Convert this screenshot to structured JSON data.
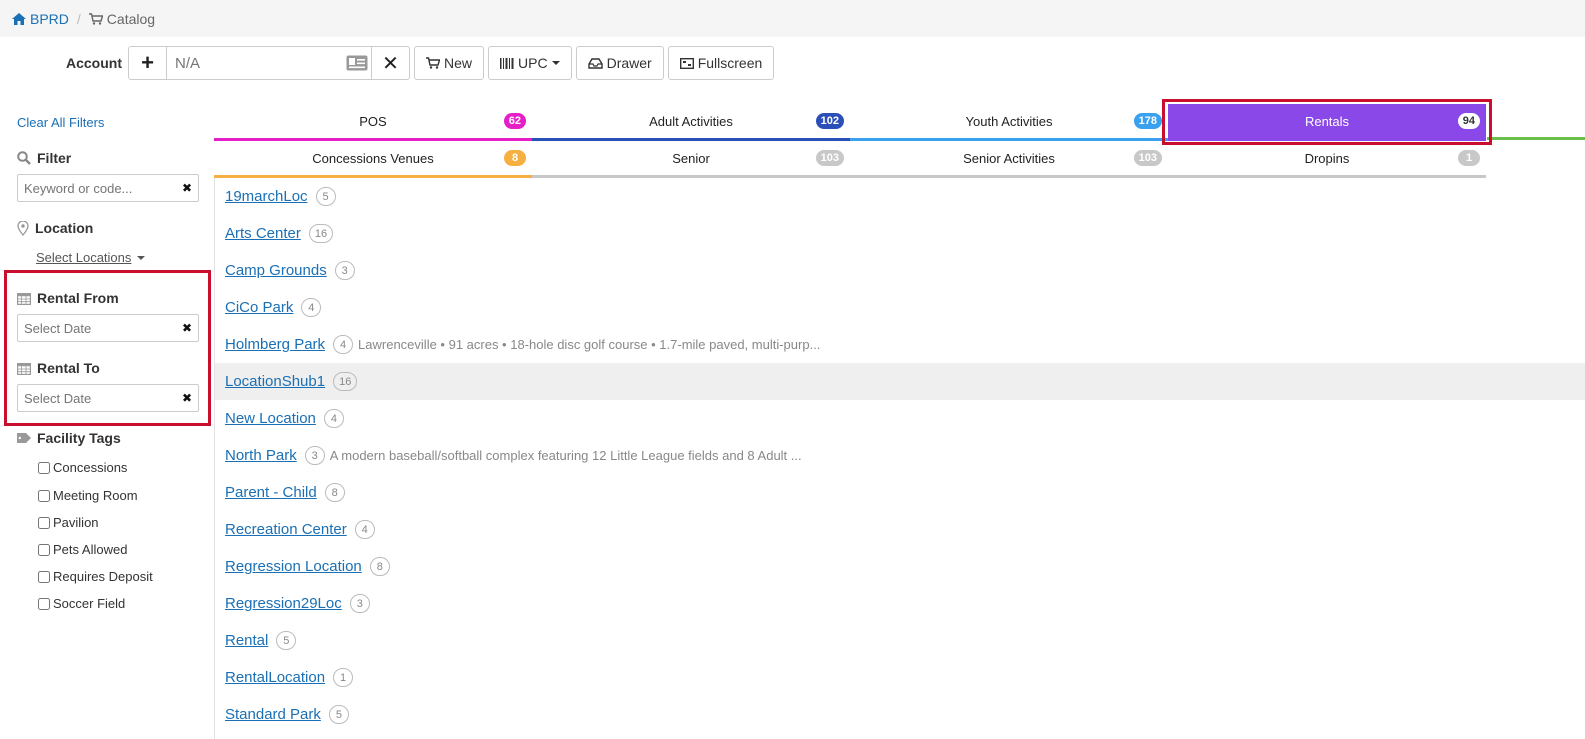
{
  "breadcrumb": {
    "home": "BPRD",
    "separator": "/",
    "current": "Catalog"
  },
  "account": {
    "label": "Account",
    "input_placeholder": "N/A",
    "buttons": {
      "new": "New",
      "upc": "UPC",
      "drawer": "Drawer",
      "fullscreen": "Fullscreen"
    }
  },
  "sidebar": {
    "clear_filters": "Clear All Filters",
    "filter": {
      "title": "Filter",
      "placeholder": "Keyword or code..."
    },
    "location": {
      "title": "Location",
      "select": "Select Locations"
    },
    "rental_from": {
      "title": "Rental From",
      "placeholder": "Select Date"
    },
    "rental_to": {
      "title": "Rental To",
      "placeholder": "Select Date"
    },
    "facility_tags": {
      "title": "Facility Tags",
      "items": [
        "Concessions",
        "Meeting Room",
        "Pavilion",
        "Pets Allowed",
        "Requires Deposit",
        "Soccer Field"
      ]
    }
  },
  "tabs": {
    "row1": [
      {
        "label": "POS",
        "count": "62",
        "color": "#e61ec8"
      },
      {
        "label": "Adult Activities",
        "count": "102",
        "color": "#2a4fb8"
      },
      {
        "label": "Youth Activities",
        "count": "178",
        "color": "#3aa0f0"
      },
      {
        "label": "Rentals",
        "count": "94",
        "color": "#8a48e8",
        "active": true
      }
    ],
    "row2": [
      {
        "label": "Concessions Venues",
        "count": "8",
        "color": "#f5b041"
      },
      {
        "label": "Senior",
        "count": "103",
        "color": "#c8c8c8"
      },
      {
        "label": "Senior Activities",
        "count": "103",
        "color": "#c8c8c8"
      },
      {
        "label": "Dropins",
        "count": "1",
        "color": "#c8c8c8"
      }
    ]
  },
  "locations": [
    {
      "name": "19marchLoc",
      "count": "5",
      "desc": ""
    },
    {
      "name": "Arts Center",
      "count": "16",
      "desc": ""
    },
    {
      "name": "Camp Grounds",
      "count": "3",
      "desc": ""
    },
    {
      "name": "CiCo Park",
      "count": "4",
      "desc": ""
    },
    {
      "name": "Holmberg Park",
      "count": "4",
      "desc": "Lawrenceville • 91 acres • 18-hole disc golf course • 1.7-mile paved, multi-purp..."
    },
    {
      "name": "LocationShub1",
      "count": "16",
      "desc": ""
    },
    {
      "name": "New Location",
      "count": "4",
      "desc": ""
    },
    {
      "name": "North Park",
      "count": "3",
      "desc": "A modern baseball/softball complex featuring 12 Little League fields and 8 Adult ..."
    },
    {
      "name": "Parent - Child",
      "count": "8",
      "desc": ""
    },
    {
      "name": "Recreation Center",
      "count": "4",
      "desc": ""
    },
    {
      "name": "Regression Location",
      "count": "8",
      "desc": ""
    },
    {
      "name": "Regression29Loc",
      "count": "3",
      "desc": ""
    },
    {
      "name": "Rental",
      "count": "5",
      "desc": ""
    },
    {
      "name": "RentalLocation",
      "count": "1",
      "desc": ""
    },
    {
      "name": "Standard Park",
      "count": "5",
      "desc": ""
    }
  ]
}
